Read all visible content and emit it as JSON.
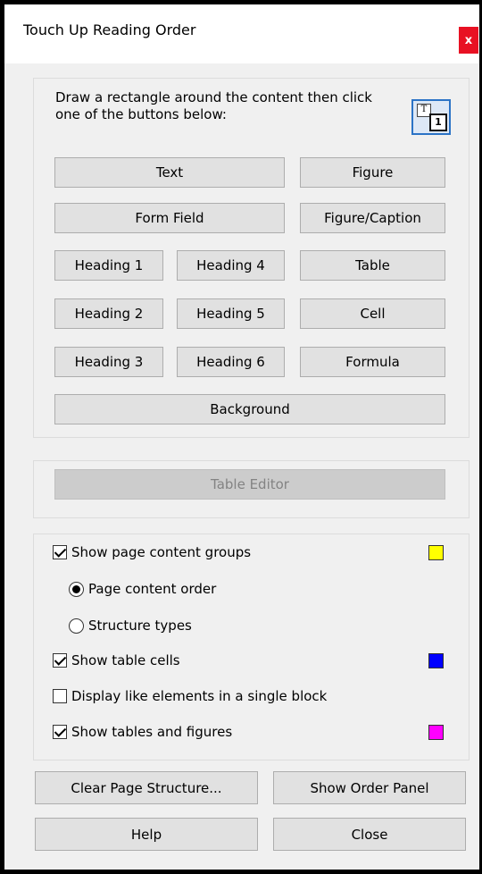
{
  "window": {
    "title": "Touch Up Reading Order",
    "close_glyph": "x"
  },
  "instructions": "Draw a rectangle around the content then click one of the buttons below:",
  "reading_order_icon": {
    "name": "touch-up-reading-order-icon",
    "glyph_a": "T",
    "glyph_b": "1"
  },
  "tag_buttons": {
    "text": "Text",
    "figure": "Figure",
    "form_field": "Form Field",
    "figure_caption": "Figure/Caption",
    "heading_1": "Heading 1",
    "heading_4": "Heading 4",
    "table": "Table",
    "heading_2": "Heading 2",
    "heading_5": "Heading 5",
    "cell": "Cell",
    "heading_3": "Heading 3",
    "heading_6": "Heading 6",
    "formula": "Formula",
    "background": "Background"
  },
  "table_editor": {
    "label": "Table Editor",
    "enabled": false
  },
  "options": {
    "show_groups": {
      "label": "Show page content groups",
      "checked": true,
      "swatch_color": "#ffff00"
    },
    "page_content_order": {
      "label": "Page content order",
      "selected": true
    },
    "structure_types": {
      "label": "Structure types",
      "selected": false
    },
    "show_table_cells": {
      "label": "Show table cells",
      "checked": true,
      "swatch_color": "#0000ff"
    },
    "display_like_elements": {
      "label": "Display like elements in a single block",
      "checked": false
    },
    "show_tables_figures": {
      "label": "Show tables and figures",
      "checked": true,
      "swatch_color": "#ff00ff"
    }
  },
  "footer": {
    "clear_structure": "Clear Page Structure...",
    "show_order_panel": "Show Order Panel",
    "help": "Help",
    "close": "Close"
  },
  "colors": {
    "close_button_red": "#e81123",
    "icon_border_blue": "#2b73c6"
  }
}
